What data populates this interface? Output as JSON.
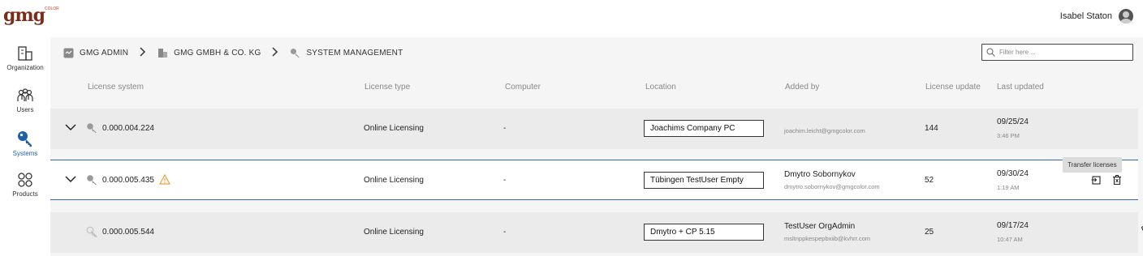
{
  "header": {
    "logo_text": "gmg",
    "logo_sup": "COLOR",
    "user_name": "Isabel Staton"
  },
  "sidebar": {
    "items": [
      {
        "label": "Organization",
        "icon": "building-icon"
      },
      {
        "label": "Users",
        "icon": "users-icon"
      },
      {
        "label": "Systems",
        "icon": "key-icon",
        "active": true
      },
      {
        "label": "Products",
        "icon": "grid-icon"
      }
    ]
  },
  "breadcrumb": {
    "items": [
      {
        "label": "GMG ADMIN",
        "icon": "admin-icon"
      },
      {
        "label": "GMG GMBH & CO. KG",
        "icon": "company-icon"
      },
      {
        "label": "SYSTEM MANAGEMENT",
        "icon": "key-icon"
      }
    ]
  },
  "filter": {
    "placeholder": "Filter here ..."
  },
  "table": {
    "headers": [
      "License system",
      "License type",
      "Computer",
      "Location",
      "Added by",
      "License update",
      "Last updated"
    ],
    "rows": [
      {
        "system": "0.000.004.224",
        "type": "Online Licensing",
        "computer": "-",
        "location": "Joachims Company PC",
        "added_name": "",
        "added_email": "joachim.leicht@gmgcolor.com",
        "update": "144",
        "date": "09/25/24",
        "time": "3:46 PM"
      },
      {
        "system": "0.000.005.435",
        "type": "Online Licensing",
        "computer": "-",
        "location": "Tübingen TestUser Empty",
        "added_name": "Dmytro Sobornykov",
        "added_email": "dmytro.sobornykov@gmgcolor.com",
        "update": "52",
        "date": "09/30/24",
        "time": "1:19 AM",
        "warning": true
      },
      {
        "system": "0.000.005.544",
        "type": "Online Licensing",
        "computer": "-",
        "location": "Dmytro + CP 5.15",
        "added_name": "TestUser OrgAdmin",
        "added_email": "msltnppkespepbxiib@kvhrr.com",
        "update": "25",
        "date": "09/17/24",
        "time": "10:47 AM"
      }
    ]
  },
  "tooltip": {
    "text": "Transfer licenses"
  },
  "colors": {
    "accent": "#1f5fa8",
    "selected_border": "#2f6bb3",
    "warning": "#e8a13a",
    "logo": "#7a2d1a"
  }
}
